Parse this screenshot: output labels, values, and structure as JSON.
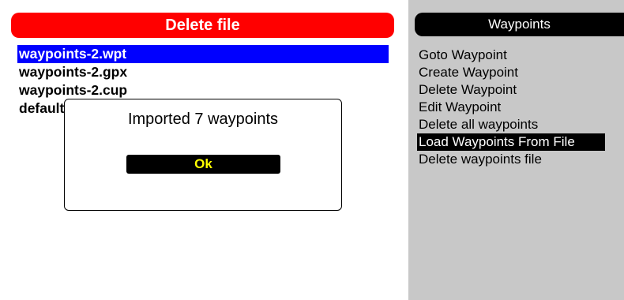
{
  "delete_panel": {
    "title": "Delete file",
    "files": [
      {
        "name": "waypoints-2.wpt",
        "selected": true
      },
      {
        "name": "waypoints-2.gpx",
        "selected": false
      },
      {
        "name": "waypoints-2.cup",
        "selected": false
      },
      {
        "name": "default.cup",
        "selected": false
      }
    ]
  },
  "dialog": {
    "message": "Imported 7 waypoints",
    "ok_label": "Ok"
  },
  "waypoints_menu": {
    "title": "Waypoints",
    "items": [
      {
        "label": "Goto Waypoint",
        "selected": false
      },
      {
        "label": "Create Waypoint",
        "selected": false
      },
      {
        "label": "Delete Waypoint",
        "selected": false
      },
      {
        "label": "Edit Waypoint",
        "selected": false
      },
      {
        "label": "Delete all waypoints",
        "selected": false
      },
      {
        "label": "Load Waypoints From File",
        "selected": true
      },
      {
        "label": "Delete waypoints file",
        "selected": false
      }
    ]
  },
  "colors": {
    "title_bar": "#ff0000",
    "selection": "#0000ff",
    "menu_background": "#c8c8c8",
    "ok_text": "#ffff00"
  }
}
